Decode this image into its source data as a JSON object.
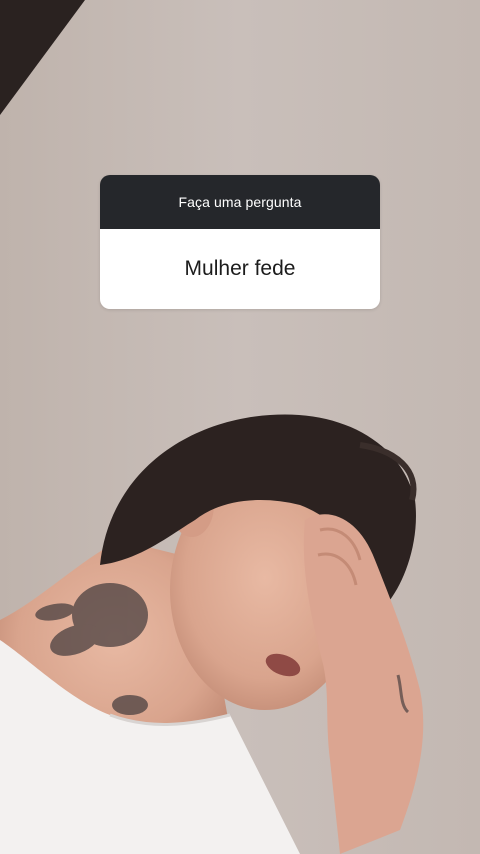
{
  "question_sticker": {
    "prompt": "Faça uma pergunta",
    "answer": "Mulher fede"
  },
  "colors": {
    "header_bg": "#25272b",
    "body_bg": "#ffffff",
    "wall": "#c6bcb6"
  }
}
